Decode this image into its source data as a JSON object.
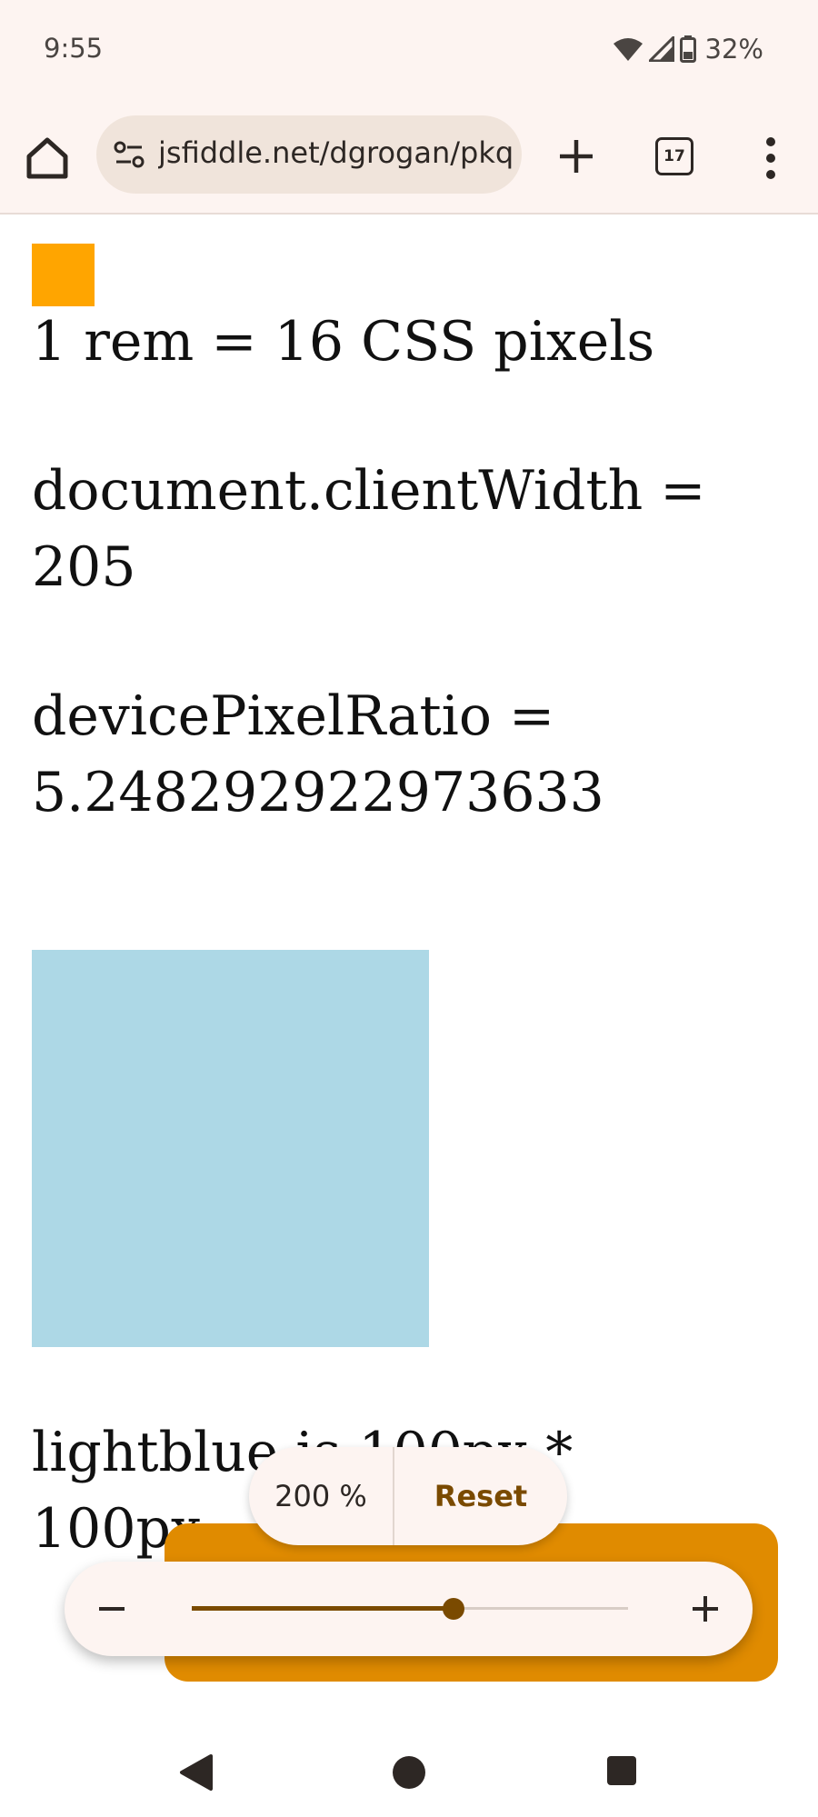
{
  "status_bar": {
    "time": "9:55",
    "battery_percent": "32%",
    "icons": [
      "wifi-icon",
      "cell-signal-icon",
      "battery-icon"
    ]
  },
  "browser": {
    "url": "jsfiddle.net/dgrogan/pkq",
    "tab_count": "17",
    "icons": [
      "home-icon",
      "site-info-icon",
      "plus-icon",
      "tab-switcher-icon",
      "overflow-menu-icon"
    ]
  },
  "page": {
    "line1": "1 rem = 16 CSS pixels",
    "line2a": "document.clientWidth =",
    "line2b": "205",
    "line3a": "devicePixelRatio =",
    "line3b": "5.248292922973633",
    "line4a": "lightblue is 100px *",
    "line4b": "100px",
    "colors": {
      "orange_square": "#ffa500",
      "lightblue_square": "#add8e6"
    }
  },
  "zoom": {
    "level_label": "200 %",
    "reset_label": "Reset",
    "slider_fraction": 0.6,
    "accent_color": "#7a4a00",
    "icons": [
      "minus-icon",
      "plus-icon"
    ]
  },
  "nav_bar": {
    "icons": [
      "back-icon",
      "home-circle-icon",
      "recents-icon"
    ]
  }
}
